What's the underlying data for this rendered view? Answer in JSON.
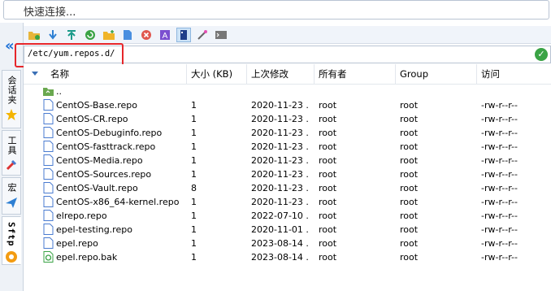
{
  "quick_connect": {
    "placeholder": "快速连接..."
  },
  "side_tabs": [
    "会话夹",
    "工具",
    "宏",
    "Sftp"
  ],
  "toolbar": {
    "icons": [
      "open-folder-icon",
      "download-icon",
      "upload-icon",
      "refresh-icon",
      "new-folder-icon",
      "new-file-icon",
      "delete-icon",
      "rename-icon",
      "toggle-panel-icon",
      "magic-wand-icon",
      "terminal-icon"
    ]
  },
  "path": {
    "value": "/etc/yum.repos.d/"
  },
  "columns": {
    "name": "名称",
    "size": "大小 (KB)",
    "date": "上次修改",
    "owner": "所有者",
    "group": "Group",
    "perm": "访问"
  },
  "files": [
    {
      "name": "..",
      "size": "",
      "date": "",
      "owner": "",
      "group": "",
      "perm": "",
      "icon": "parent-folder-icon"
    },
    {
      "name": "CentOS-Base.repo",
      "size": "1",
      "date": "2020-11-23 ...",
      "owner": "root",
      "group": "root",
      "perm": "-rw-r--r--",
      "icon": "file-icon"
    },
    {
      "name": "CentOS-CR.repo",
      "size": "1",
      "date": "2020-11-23 ...",
      "owner": "root",
      "group": "root",
      "perm": "-rw-r--r--",
      "icon": "file-icon"
    },
    {
      "name": "CentOS-Debuginfo.repo",
      "size": "1",
      "date": "2020-11-23 ...",
      "owner": "root",
      "group": "root",
      "perm": "-rw-r--r--",
      "icon": "file-icon"
    },
    {
      "name": "CentOS-fasttrack.repo",
      "size": "1",
      "date": "2020-11-23 ...",
      "owner": "root",
      "group": "root",
      "perm": "-rw-r--r--",
      "icon": "file-icon"
    },
    {
      "name": "CentOS-Media.repo",
      "size": "1",
      "date": "2020-11-23 ...",
      "owner": "root",
      "group": "root",
      "perm": "-rw-r--r--",
      "icon": "file-icon"
    },
    {
      "name": "CentOS-Sources.repo",
      "size": "1",
      "date": "2020-11-23 ...",
      "owner": "root",
      "group": "root",
      "perm": "-rw-r--r--",
      "icon": "file-icon"
    },
    {
      "name": "CentOS-Vault.repo",
      "size": "8",
      "date": "2020-11-23 ...",
      "owner": "root",
      "group": "root",
      "perm": "-rw-r--r--",
      "icon": "file-icon"
    },
    {
      "name": "CentOS-x86_64-kernel.repo",
      "size": "1",
      "date": "2020-11-23 ...",
      "owner": "root",
      "group": "root",
      "perm": "-rw-r--r--",
      "icon": "file-icon"
    },
    {
      "name": "elrepo.repo",
      "size": "1",
      "date": "2022-07-10 ...",
      "owner": "root",
      "group": "root",
      "perm": "-rw-r--r--",
      "icon": "file-icon"
    },
    {
      "name": "epel-testing.repo",
      "size": "1",
      "date": "2020-11-01 ...",
      "owner": "root",
      "group": "root",
      "perm": "-rw-r--r--",
      "icon": "file-icon"
    },
    {
      "name": "epel.repo",
      "size": "1",
      "date": "2023-08-14 ...",
      "owner": "root",
      "group": "root",
      "perm": "-rw-r--r--",
      "icon": "file-icon"
    },
    {
      "name": "epel.repo.bak",
      "size": "1",
      "date": "2023-08-14 ...",
      "owner": "root",
      "group": "root",
      "perm": "-rw-r--r--",
      "icon": "backup-file-icon"
    }
  ],
  "colors": {
    "accent": "#1a6fd6",
    "highlight_box": "#e6262a",
    "ok_green": "#3aa345"
  }
}
